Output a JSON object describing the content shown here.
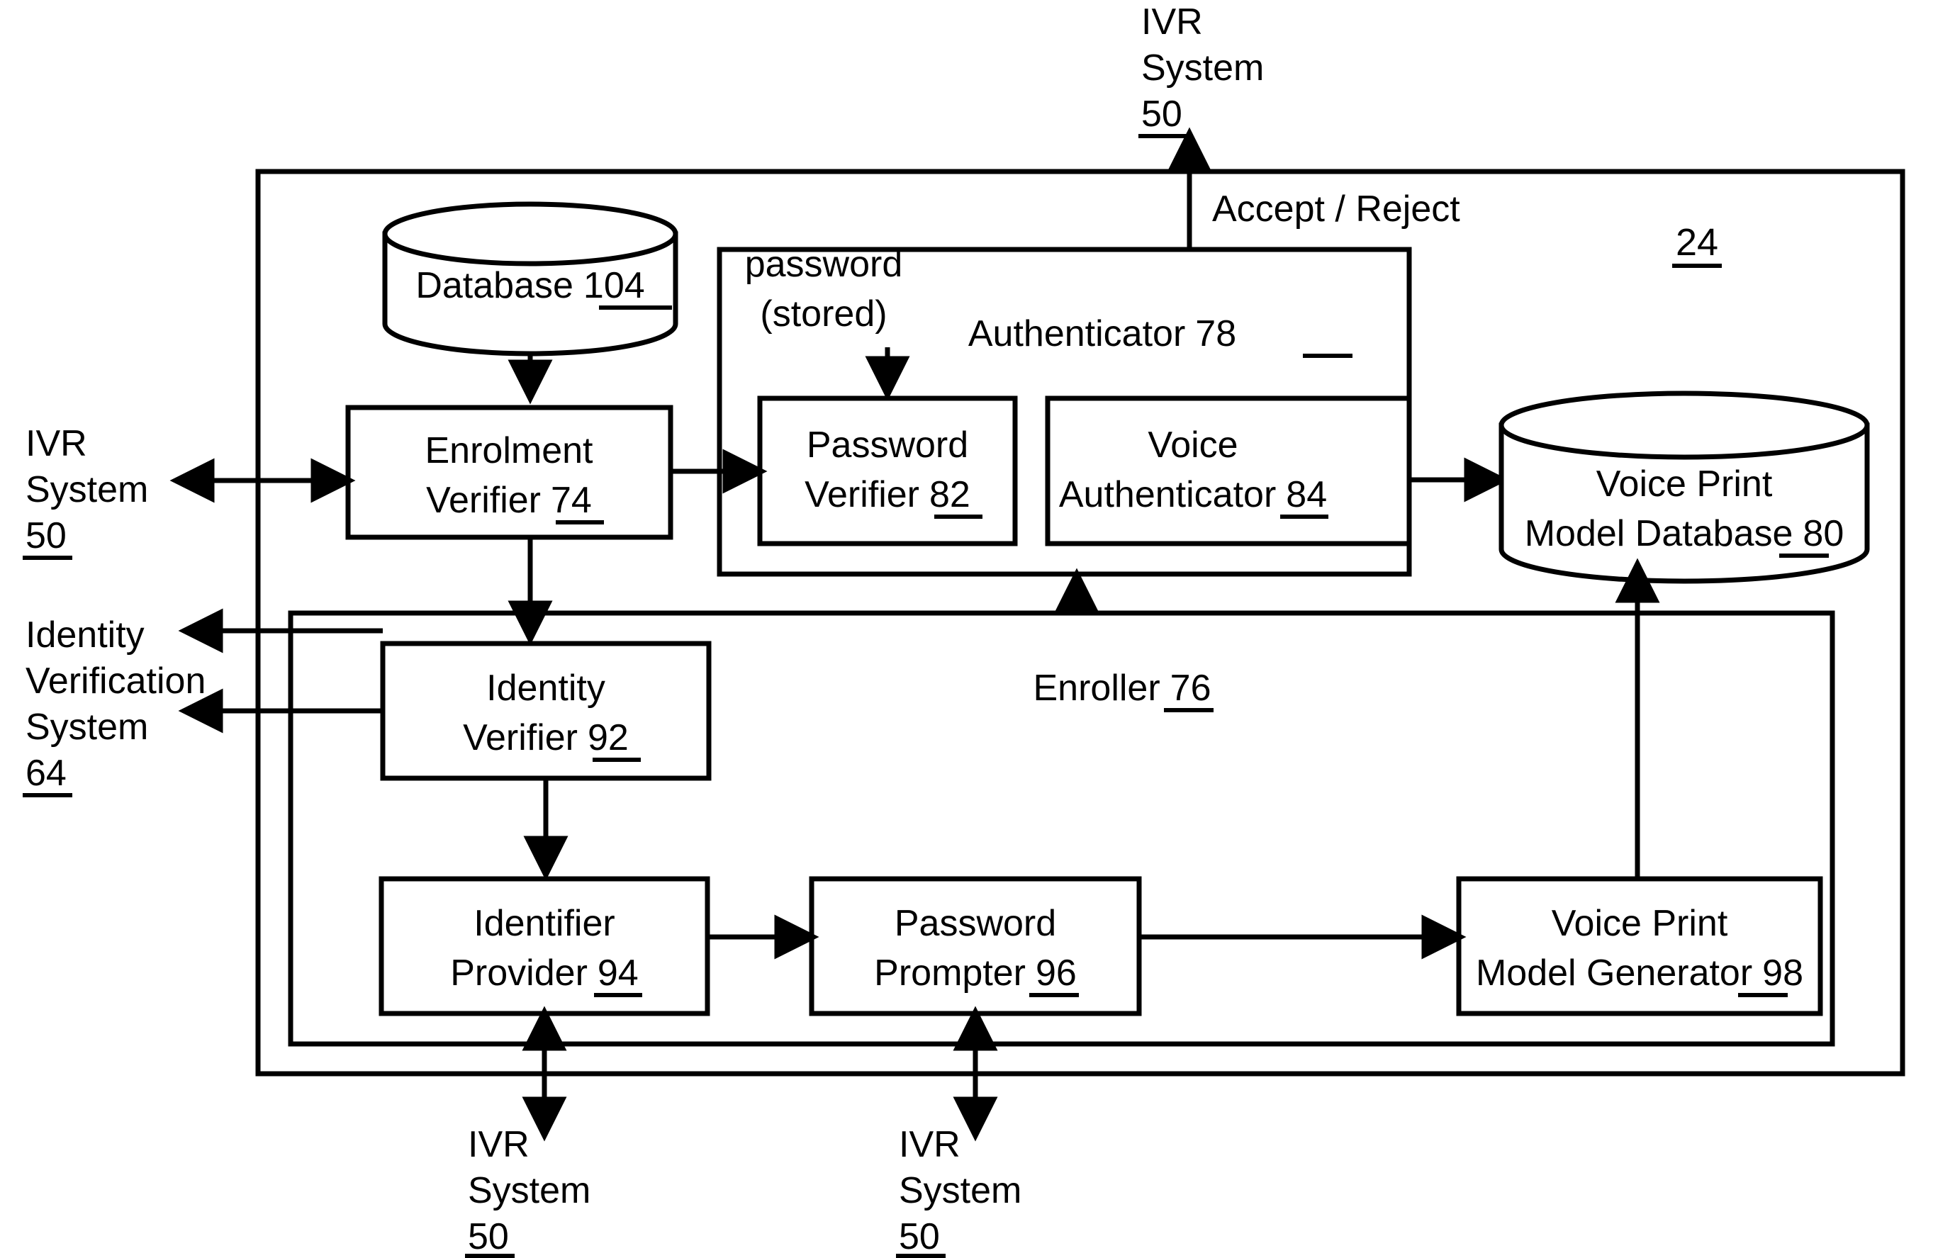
{
  "figure": {
    "outer_container_ref": "24",
    "background": "#ffffff",
    "line_color": "#000000"
  },
  "external_labels": {
    "top_ivr": {
      "line1": "IVR",
      "line2": "System",
      "ref": "50"
    },
    "left_ivr": {
      "line1": "IVR",
      "line2": "System",
      "ref": "50"
    },
    "left_identity": {
      "line1": "Identity",
      "line2": "Verification",
      "line3": "System",
      "ref": "64"
    },
    "bottom_ivr_left": {
      "line1": "IVR",
      "line2": "System",
      "ref": "50"
    },
    "bottom_ivr_right": {
      "line1": "IVR",
      "line2": "System",
      "ref": "50"
    }
  },
  "annotations": {
    "accept_reject": "Accept / Reject",
    "password_stored_line1": "password",
    "password_stored_line2": "(stored)"
  },
  "groups": {
    "authenticator": {
      "label": "Authenticator",
      "ref": "78"
    },
    "enroller": {
      "label": "Enroller",
      "ref": "76"
    }
  },
  "nodes": {
    "database_104": {
      "type": "cylinder",
      "label": "Database",
      "ref": "104"
    },
    "enrolment_verifier_74": {
      "type": "box",
      "line1": "Enrolment",
      "line2": "Verifier",
      "ref": "74"
    },
    "password_verifier_82": {
      "type": "box",
      "line1": "Password",
      "line2": "Verifier",
      "ref": "82"
    },
    "voice_authenticator_84": {
      "type": "box",
      "line1": "Voice",
      "line2": "Authenticator",
      "ref": "84"
    },
    "voice_print_model_database_80": {
      "type": "cylinder",
      "line1": "Voice Print",
      "line2": "Model Database",
      "ref": "80"
    },
    "identity_verifier_92": {
      "type": "box",
      "line1": "Identity",
      "line2": "Verifier",
      "ref": "92"
    },
    "identifier_provider_94": {
      "type": "box",
      "line1": "Identifier",
      "line2": "Provider",
      "ref": "94"
    },
    "password_prompter_96": {
      "type": "box",
      "line1": "Password",
      "line2": "Prompter",
      "ref": "96"
    },
    "voice_print_model_generator_98": {
      "type": "box",
      "line1": "Voice Print",
      "line2": "Model Generator",
      "ref": "98"
    }
  }
}
